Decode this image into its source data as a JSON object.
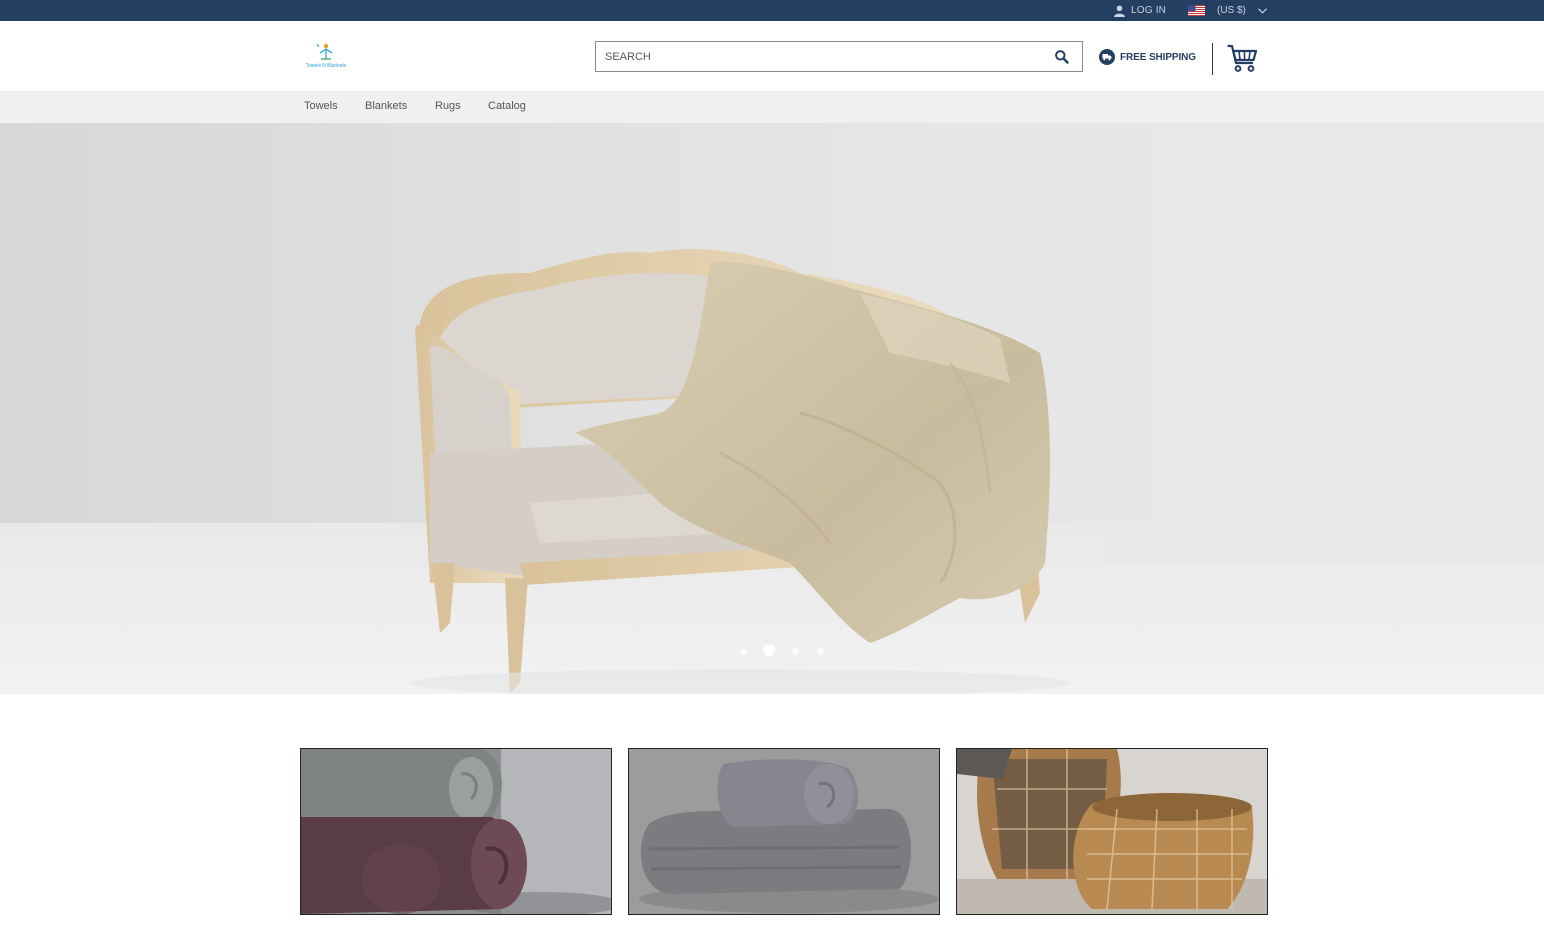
{
  "topbar": {
    "login_label": "LOG IN",
    "currency_label": "(US $)"
  },
  "header": {
    "logo_text": "Towels N Blankets",
    "search_placeholder": "SEARCH",
    "shipping_label": "FREE SHIPPING"
  },
  "nav": {
    "items": [
      "Towels",
      "Blankets",
      "Rugs",
      "Catalog"
    ]
  },
  "hero": {
    "slide_count": 4,
    "active_slide": 2
  },
  "colors": {
    "topbar": "#253f63",
    "nav_background": "#f0f0f1",
    "accent": "#253f63"
  }
}
